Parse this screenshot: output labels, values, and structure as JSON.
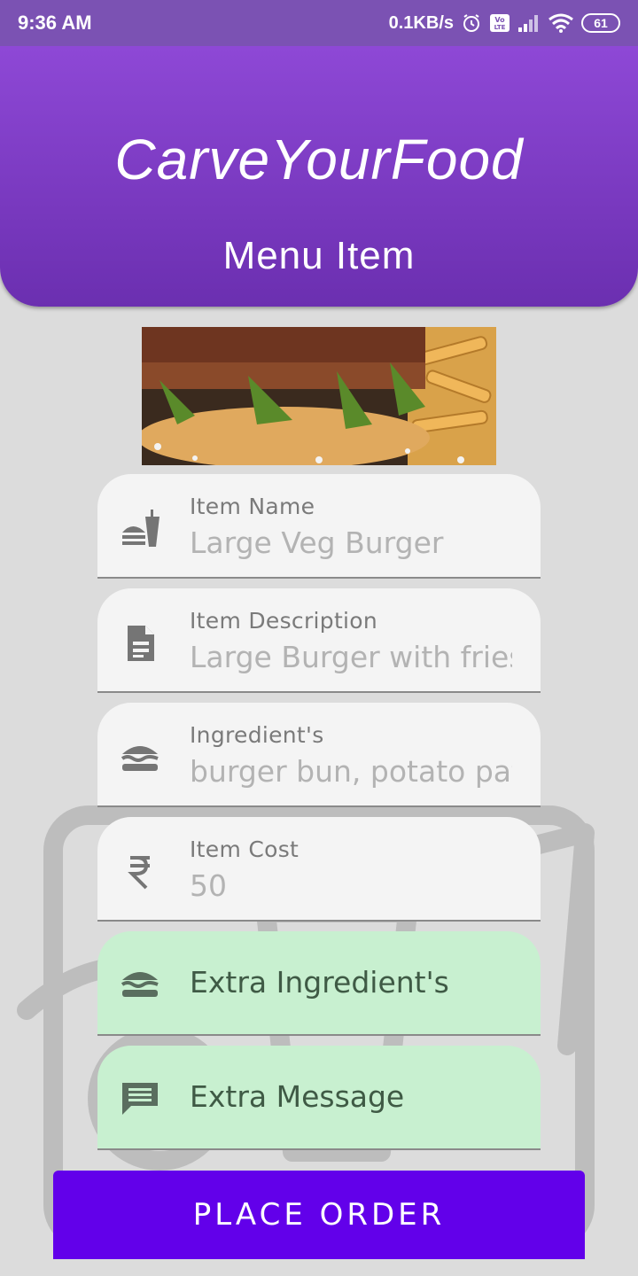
{
  "status_bar": {
    "time": "9:36 AM",
    "network_speed": "0.1KB/s",
    "battery_level": "61",
    "icons": [
      "alarm-icon",
      "volte-icon",
      "signal-icon",
      "wifi-icon",
      "battery-icon"
    ]
  },
  "header": {
    "app_title": "CarveYourFood",
    "page_title": "Menu Item",
    "gradient": [
      "#8e48d6",
      "#6b2fb0"
    ]
  },
  "image": {
    "subject": "burger with fries"
  },
  "form": {
    "item_name": {
      "label": "Item Name",
      "value": "Large Veg Burger",
      "icon": "fastfood-icon"
    },
    "item_description": {
      "label": "Item Description",
      "value": "Large Burger with fries",
      "icon": "document-icon"
    },
    "ingredients": {
      "label": "Ingredient's",
      "value": "burger bun, potato patty",
      "icon": "burger-icon"
    },
    "item_cost": {
      "label": "Item Cost",
      "value": "50",
      "icon": "rupee-icon"
    }
  },
  "buttons": {
    "extra_ingredients": {
      "label": "Extra Ingredient's",
      "icon": "burger-icon"
    },
    "extra_message": {
      "label": "Extra Message",
      "icon": "message-icon"
    },
    "place_order": {
      "label": "PLACE ORDER"
    }
  },
  "colors": {
    "accent": "#6200ea",
    "field_background": "#f4f4f4",
    "green_button": "#c8f0d0"
  }
}
